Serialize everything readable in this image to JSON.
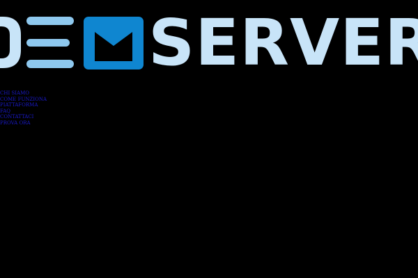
{
  "brand": {
    "logo_text": "SERVER",
    "colors": {
      "logo_light": "#c8e4f8",
      "logo_stripes": "#8ec8ee",
      "logo_envelope": "#0f86d0",
      "background": "#000000",
      "nav_link": "#1a1acc"
    }
  },
  "nav": {
    "items": [
      {
        "label": "CHI SIAMO"
      },
      {
        "label": "COME FUNZIONA"
      },
      {
        "label": "PIATTAFORMA"
      },
      {
        "label": "FAQ"
      },
      {
        "label": "CONTATTACI"
      },
      {
        "label": "PROVA ORA"
      }
    ]
  }
}
